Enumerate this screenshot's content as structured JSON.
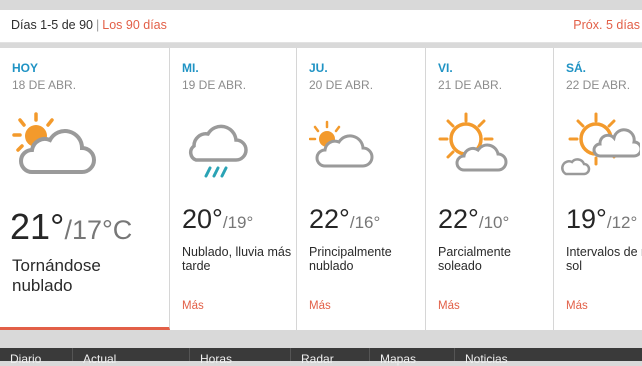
{
  "header": {
    "range_label": "Días 1-5 de 90",
    "separator": "|",
    "link_90": "Los 90 días",
    "next_label": "Próx. 5 días"
  },
  "days": [
    {
      "name": "HOY",
      "date": "18 DE ABR.",
      "high": "21°",
      "low": "/17°C",
      "desc": "Tornándose nublado",
      "more": "",
      "icon": "partly-cloudy-icon"
    },
    {
      "name": "MI.",
      "date": "19 DE ABR.",
      "high": "20°",
      "low": "/19°",
      "desc": "Nublado, lluvia más tarde",
      "more": "Más",
      "icon": "cloud-rain-icon"
    },
    {
      "name": "JU.",
      "date": "20 DE ABR.",
      "high": "22°",
      "low": "/16°",
      "desc": "Principalmente nublado",
      "more": "Más",
      "icon": "mostly-cloudy-icon"
    },
    {
      "name": "VI.",
      "date": "21 DE ABR.",
      "high": "22°",
      "low": "/10°",
      "desc": "Parcialmente soleado",
      "more": "Más",
      "icon": "partly-sunny-icon"
    },
    {
      "name": "SÁ.",
      "date": "22 DE ABR.",
      "high": "19°",
      "low": "/12°",
      "desc": "Intervalos de nubes y sol",
      "more": "Más",
      "icon": "sun-cloud-intervals-icon"
    }
  ],
  "footer_tabs": [
    "Diario",
    "Actual",
    "Horas",
    "Radar",
    "Mapas",
    "Noticias"
  ],
  "colors": {
    "accent": "#e25f47",
    "day_name": "#1f93c4",
    "sun": "#f39a2c",
    "cloud": "#9a9a9a",
    "rain": "#2aa3b5"
  }
}
